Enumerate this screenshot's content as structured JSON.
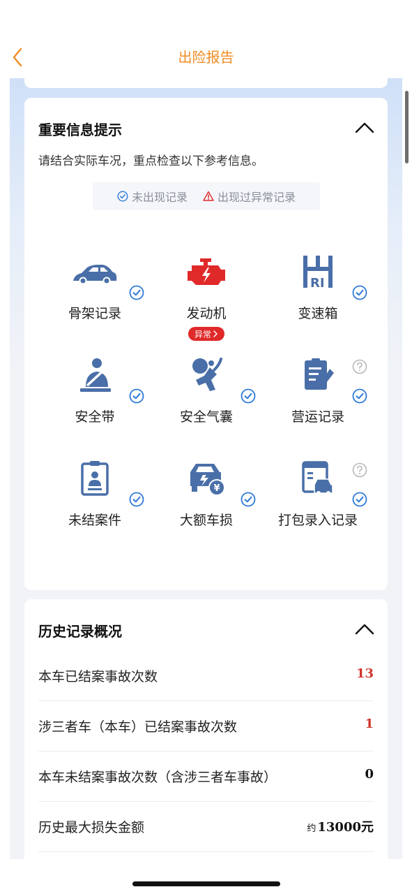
{
  "header": {
    "title": "出险报告",
    "back_icon": "chevron-left-icon"
  },
  "colors": {
    "accent": "#f08c22",
    "icon_blue": "#4a6fa8",
    "check_blue": "#2f7ad8",
    "warning_red": "#e02929",
    "bg_blue": "#cfe0f7"
  },
  "important": {
    "title": "重要信息提示",
    "subtitle": "请结合实际车况，重点检查以下参考信息。",
    "legend": {
      "normal": "未出现记录",
      "abnormal": "出现过异常记录"
    },
    "items": [
      {
        "label": "骨架记录",
        "icon": "car-frame-icon",
        "status": "normal"
      },
      {
        "label": "发动机",
        "icon": "engine-icon",
        "status": "abnormal",
        "badge": "异常"
      },
      {
        "label": "变速箱",
        "icon": "gearbox-icon",
        "status": "normal"
      },
      {
        "label": "安全带",
        "icon": "seatbelt-icon",
        "status": "normal"
      },
      {
        "label": "安全气囊",
        "icon": "airbag-icon",
        "status": "normal"
      },
      {
        "label": "营运记录",
        "icon": "operation-record-icon",
        "status": "normal",
        "help_icon": "question-icon"
      },
      {
        "label": "未结案件",
        "icon": "open-case-icon",
        "status": "normal"
      },
      {
        "label": "大额车损",
        "icon": "large-damage-icon",
        "status": "normal"
      },
      {
        "label": "打包录入记录",
        "icon": "package-entry-icon",
        "status": "normal",
        "help_icon": "question-icon"
      }
    ]
  },
  "history": {
    "title": "历史记录概况",
    "rows": [
      {
        "label": "本车已结案事故次数",
        "value": "13",
        "color": "#d0352b"
      },
      {
        "label": "涉三者车（本车）已结案事故次数",
        "value": "1",
        "color": "#d0352b"
      },
      {
        "label": "本车未结案事故次数（含涉三者车事故）",
        "value": "0",
        "color": "#111111"
      },
      {
        "label": "历史最大损失金额",
        "prefix": "约",
        "value": "13000元",
        "color": "#111111"
      }
    ]
  }
}
